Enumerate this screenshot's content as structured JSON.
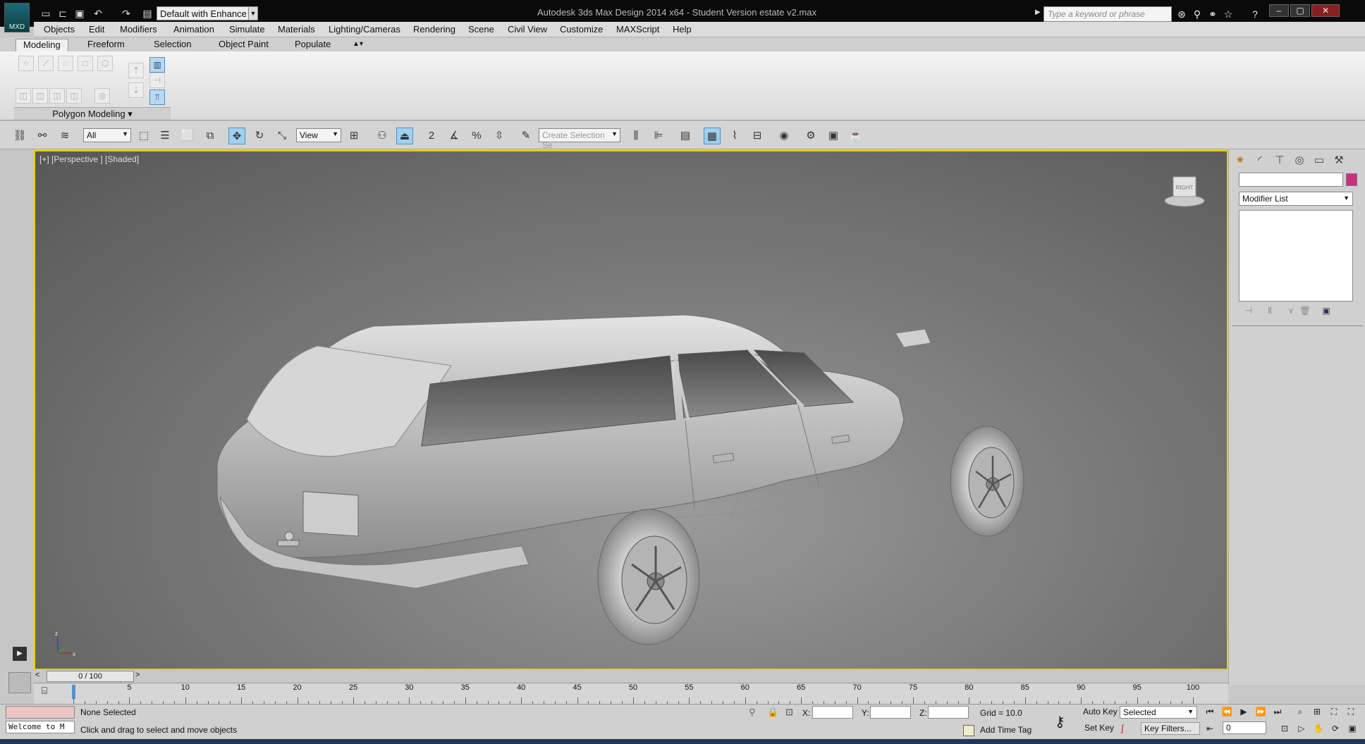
{
  "app": {
    "title": "Autodesk 3ds Max Design 2014 x64 - Student Version   estate v2.max",
    "logo_label": "MXD",
    "workspace": "Default with Enhance",
    "search_placeholder": "Type a keyword or phrase"
  },
  "menu": [
    "Objects",
    "Edit",
    "Modifiers",
    "Animation",
    "Simulate",
    "Materials",
    "Lighting/Cameras",
    "Rendering",
    "Scene",
    "Civil View",
    "Customize",
    "MAXScript",
    "Help"
  ],
  "ribbon": {
    "tabs": [
      "Modeling",
      "Freeform",
      "Selection",
      "Object Paint",
      "Populate"
    ],
    "active_tab": "Modeling",
    "panel_label": "Polygon Modeling"
  },
  "toolbar": {
    "selection_filter": "All",
    "ref_coord": "View",
    "named_selection": "Create Selection Se",
    "snap_label": "2"
  },
  "viewport": {
    "label": "[+] [Perspective ] [Shaded]",
    "viewcube_face": "RIGHT"
  },
  "command_panel": {
    "modifier_list": "Modifier List",
    "object_color": "#cc2f7f"
  },
  "timeline": {
    "position": "0 / 100",
    "ticks": [
      5,
      10,
      15,
      20,
      25,
      30,
      35,
      40,
      45,
      50,
      55,
      60,
      65,
      70,
      75,
      80,
      85,
      90,
      95,
      100
    ],
    "current": 0
  },
  "status": {
    "maxscript": "Welcome to M",
    "selection": "None Selected",
    "prompt": "Click and drag to select and move objects",
    "x_label": "X:",
    "y_label": "Y:",
    "z_label": "Z:",
    "grid": "Grid = 10.0",
    "add_time_tag": "Add Time Tag",
    "auto_key": "Auto Key",
    "set_key": "Set Key",
    "key_mode": "Selected",
    "key_filters": "Key Filters...",
    "frame": "0"
  }
}
